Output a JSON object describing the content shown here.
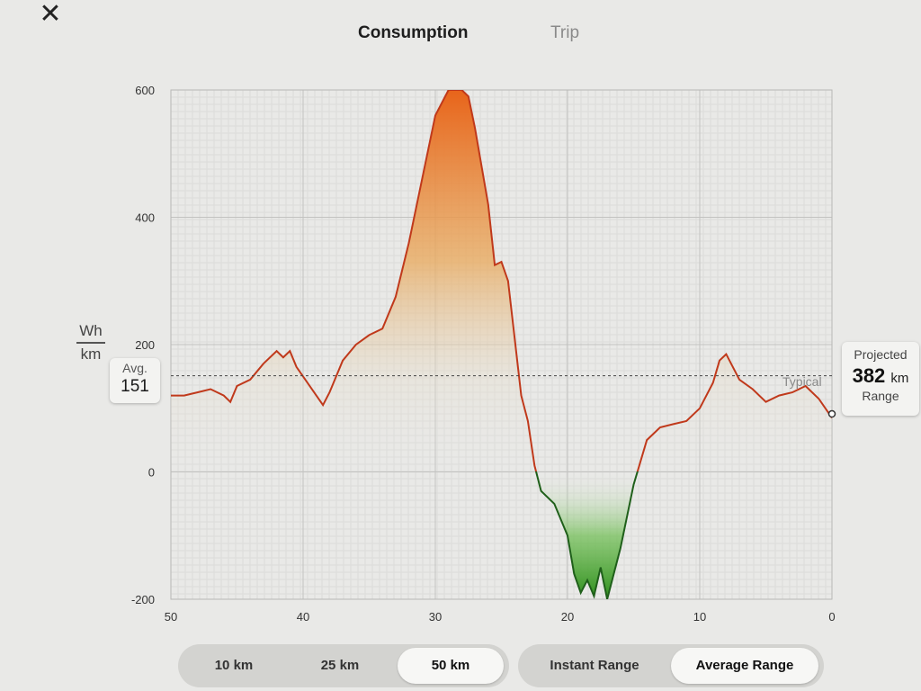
{
  "window": {
    "close_glyph": "✕"
  },
  "tabs": [
    {
      "label": "Consumption",
      "active": true
    },
    {
      "label": "Trip",
      "active": false
    }
  ],
  "unit": {
    "top": "Wh",
    "bottom": "km"
  },
  "average": {
    "label": "Avg.",
    "value": "151"
  },
  "projected": {
    "label_top": "Projected",
    "value": "382",
    "unit": "km",
    "label_bottom": "Range"
  },
  "typical_label": "Typical",
  "range_buttons": [
    {
      "label": "10 km",
      "selected": false
    },
    {
      "label": "25 km",
      "selected": false
    },
    {
      "label": "50 km",
      "selected": true
    }
  ],
  "mode_buttons": [
    {
      "label": "Instant Range",
      "selected": false
    },
    {
      "label": "Average Range",
      "selected": true
    }
  ],
  "colors": {
    "line": "#c0391b",
    "regen_line": "#1f5f1a",
    "high": "#e86a17",
    "mid": "#e9a85a",
    "regen": "#3a9a25"
  },
  "chart_data": {
    "type": "area",
    "xlabel": "",
    "ylabel": "Wh/km",
    "x_ticks": [
      50,
      40,
      30,
      20,
      10,
      0
    ],
    "y_ticks": [
      600,
      400,
      200,
      0,
      -200
    ],
    "xlim": [
      50,
      0
    ],
    "ylim": [
      -200,
      600
    ],
    "average_line": 151,
    "x": [
      50,
      49,
      48,
      47,
      46,
      45.5,
      45,
      44,
      43,
      42,
      41.5,
      41,
      40.5,
      40,
      39,
      38.5,
      38,
      37,
      36,
      35,
      34,
      33,
      32,
      31,
      30,
      29,
      28,
      27.5,
      27,
      26,
      25.5,
      25,
      24.5,
      24,
      23.5,
      23,
      22.5,
      22,
      21,
      20,
      19.5,
      19,
      18.5,
      18,
      17.5,
      17,
      16,
      15,
      14,
      13,
      12,
      11,
      10,
      9,
      8.5,
      8,
      7,
      6,
      5,
      4,
      3,
      2,
      1,
      0
    ],
    "y": [
      120,
      120,
      125,
      130,
      120,
      110,
      135,
      145,
      170,
      190,
      180,
      190,
      165,
      150,
      120,
      105,
      125,
      175,
      200,
      215,
      225,
      275,
      360,
      460,
      560,
      600,
      600,
      590,
      540,
      420,
      325,
      330,
      300,
      210,
      120,
      80,
      10,
      -30,
      -50,
      -100,
      -160,
      -190,
      -170,
      -195,
      -150,
      -200,
      -120,
      -20,
      50,
      70,
      75,
      80,
      100,
      140,
      175,
      185,
      145,
      130,
      110,
      120,
      125,
      135,
      115,
      85
    ]
  }
}
